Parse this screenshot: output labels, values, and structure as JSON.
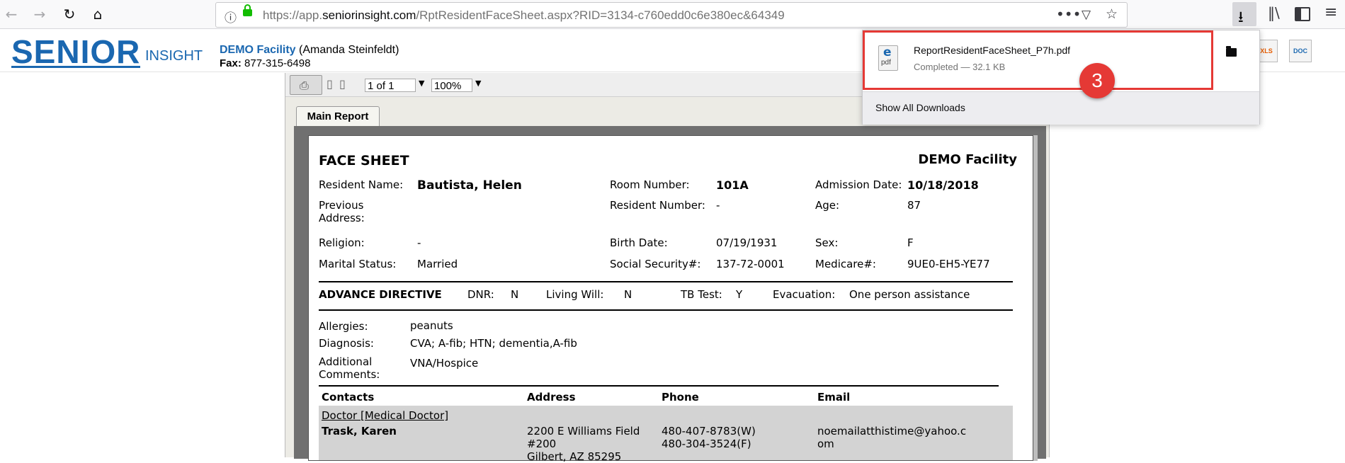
{
  "browser": {
    "url_prefix": "https://app.",
    "url_host": "seniorinsight.com",
    "url_path": "/RptResidentFaceSheet.aspx?RID=3134-c760edd0c6e380ec&64349",
    "icons": [
      "back-icon",
      "forward-icon",
      "reload-icon",
      "home-icon",
      "info-icon",
      "lock-icon",
      "more-icon",
      "pocket-icon",
      "star-icon",
      "download-icon",
      "library-icon",
      "sidebar-icon",
      "menu-icon"
    ]
  },
  "header": {
    "logo_main": "SENIOR",
    "logo_sub": "INSIGHT",
    "facility_name": "DEMO Facility",
    "user_name": "(Amanda Steinfeldt)",
    "fax_label": "Fax:",
    "fax_number": "877-315-6498",
    "export_xls": "XLS",
    "export_doc": "DOC"
  },
  "viewer": {
    "page_indicator": "1 of 1",
    "zoom": "100%",
    "tab_label": "Main Report"
  },
  "report": {
    "title": "FACE SHEET",
    "facility": "DEMO Facility",
    "resident_name_label": "Resident Name:",
    "resident_name": "Bautista, Helen",
    "room_label": "Room Number:",
    "room": "101A",
    "admission_label": "Admission Date:",
    "admission": "10/18/2018",
    "prev_address_label": "Previous Address:",
    "resident_number_label": "Resident Number:",
    "resident_number": "-",
    "age_label": "Age:",
    "age": "87",
    "religion_label": "Religion:",
    "religion": "-",
    "birth_label": "Birth Date:",
    "birth": "07/19/1931",
    "sex_label": "Sex:",
    "sex": "F",
    "marital_label": "Marital Status:",
    "marital": "Married",
    "ssn_label": "Social Security#:",
    "ssn": "137-72-0001",
    "medicare_label": "Medicare#:",
    "medicare": "9UE0-EH5-YE77",
    "advance_label": "ADVANCE DIRECTIVE",
    "dnr_label": "DNR:",
    "dnr": "N",
    "living_will_label": "Living Will:",
    "living_will": "N",
    "tb_label": "TB Test:",
    "tb": "Y",
    "evac_label": "Evacuation:",
    "evac": "One person assistance",
    "allergies_label": "Allergies:",
    "allergies": "peanuts",
    "diagnosis_label": "Diagnosis:",
    "diagnosis": "CVA; A-fib; HTN; dementia,A-fib",
    "comments_label_1": "Additional",
    "comments_label_2": "Comments:",
    "comments": "VNA/Hospice",
    "contacts_header": "Contacts",
    "address_header": "Address",
    "phone_header": "Phone",
    "email_header": "Email",
    "contact_type": "Doctor [Medical Doctor]",
    "contact_name": "Trask, Karen",
    "address_1": "2200 E Williams Field",
    "address_2": "#200",
    "address_3": "Gilbert, AZ 85295",
    "phone_1": "480-407-8783(W)",
    "phone_2": "480-304-3524(F)",
    "email_1": "noemailatthistime@yahoo.c",
    "email_2": "om"
  },
  "downloads": {
    "file_name": "ReportResidentFaceSheet_P7h.pdf",
    "status": "Completed — 32.1 KB",
    "file_icon_label": "pdf",
    "show_all": "Show All Downloads",
    "step_number": "3"
  },
  "colors": {
    "brand": "#1a67b0",
    "highlight": "#e53935"
  }
}
